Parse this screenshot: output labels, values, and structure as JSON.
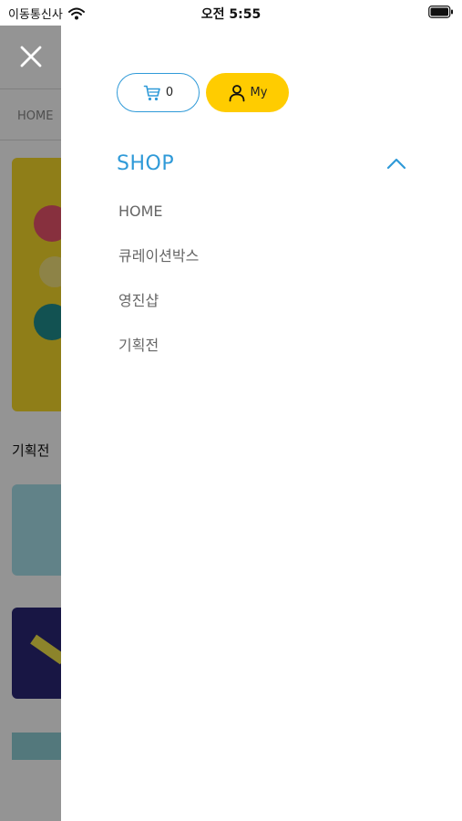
{
  "status_bar": {
    "carrier": "이동통신사",
    "time": "오전 5:55"
  },
  "background_page": {
    "breadcrumb_home": "HOME",
    "section_title": "기획전"
  },
  "drawer": {
    "cart_count": "0",
    "my_label": "My",
    "shop": {
      "title": "SHOP",
      "items": [
        {
          "label": "HOME"
        },
        {
          "label": "큐레이션박스"
        },
        {
          "label": "영진샵"
        },
        {
          "label": "기획전"
        }
      ]
    }
  },
  "colors": {
    "accent_blue": "#2f9ad8",
    "accent_yellow": "#ffcc00"
  },
  "icons": [
    "wifi-icon",
    "battery-icon",
    "close-icon",
    "cart-icon",
    "user-icon",
    "chevron-up-icon"
  ]
}
